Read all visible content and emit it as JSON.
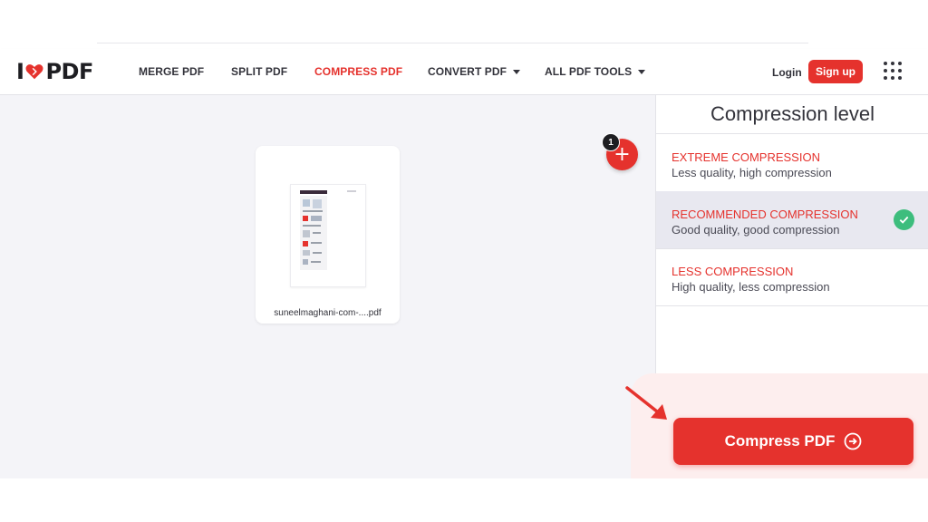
{
  "app": {
    "logo_text_left": "I",
    "logo_text_right": "PDF"
  },
  "nav": {
    "items": [
      {
        "label": "MERGE PDF",
        "active": false,
        "dropdown": false
      },
      {
        "label": "SPLIT PDF",
        "active": false,
        "dropdown": false
      },
      {
        "label": "COMPRESS PDF",
        "active": true,
        "dropdown": false
      },
      {
        "label": "CONVERT PDF",
        "active": false,
        "dropdown": true
      },
      {
        "label": "ALL PDF TOOLS",
        "active": false,
        "dropdown": true
      }
    ],
    "login_label": "Login",
    "signup_label": "Sign up",
    "apps_icon": "grid-icon"
  },
  "workspace": {
    "file": {
      "name": "suneelmaghani-com-....pdf"
    },
    "file_count": "1",
    "add_icon": "plus-icon"
  },
  "sidebar": {
    "title": "Compression level",
    "options": [
      {
        "title": "EXTREME COMPRESSION",
        "description": "Less quality, high compression",
        "selected": false
      },
      {
        "title": "RECOMMENDED COMPRESSION",
        "description": "Good quality, good compression",
        "selected": true
      },
      {
        "title": "LESS COMPRESSION",
        "description": "High quality, less compression",
        "selected": false
      }
    ]
  },
  "action": {
    "compress_label": "Compress PDF",
    "icon": "arrow-right-circle-icon"
  },
  "colors": {
    "brand": "#e5322d",
    "check": "#3dbd7d",
    "workspace_bg": "#f4f4f8"
  }
}
